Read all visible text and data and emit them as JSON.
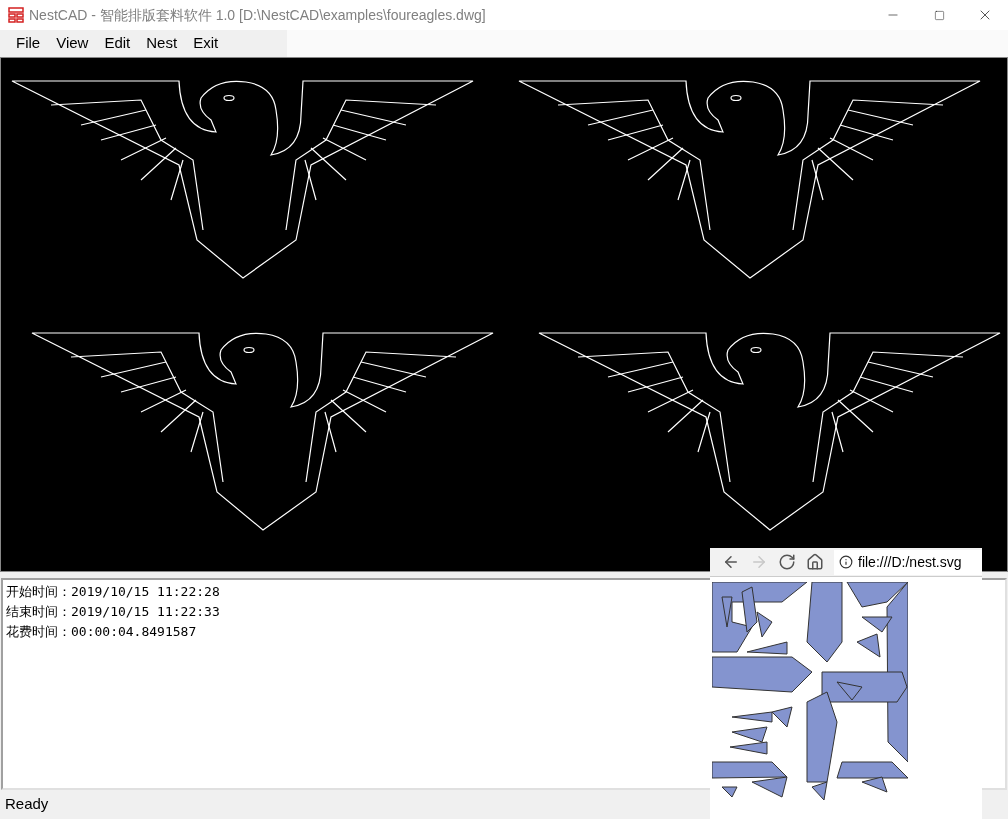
{
  "window": {
    "title": "NestCAD - 智能排版套料软件 1.0 [D:\\NestCAD\\examples\\foureagles.dwg]"
  },
  "menu": [
    {
      "label": "File"
    },
    {
      "label": "View"
    },
    {
      "label": "Edit"
    },
    {
      "label": "Nest"
    },
    {
      "label": "Exit"
    }
  ],
  "log_lines": [
    "开始时间：2019/10/15 11:22:28",
    "结束时间：2019/10/15 11:22:33",
    "花费时间：00:00:04.8491587"
  ],
  "browser": {
    "buttons": [
      {
        "kind": "back",
        "disabled": false
      },
      {
        "kind": "forward",
        "disabled": true
      },
      {
        "kind": "reload",
        "disabled": false
      },
      {
        "kind": "home",
        "disabled": false
      }
    ],
    "address": "file:///D:/nest.svg"
  },
  "status_bar": "Ready"
}
